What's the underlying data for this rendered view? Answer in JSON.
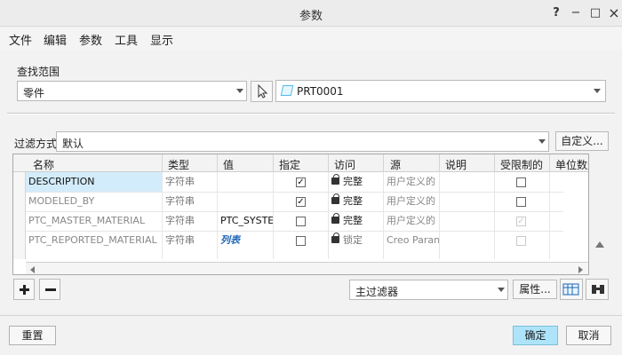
{
  "window": {
    "title": "参数",
    "help_label": "?",
    "minimize_label": "−",
    "maximize_label": "□",
    "close_label": "×"
  },
  "menu": [
    "文件",
    "编辑",
    "参数",
    "工具",
    "显示"
  ],
  "search_scope": {
    "label": "查找范围",
    "type_value": "零件",
    "object_value": "PRT0001"
  },
  "filter": {
    "label": "过滤方式",
    "value": "默认",
    "custom_button": "自定义..."
  },
  "table": {
    "columns": [
      "名称",
      "类型",
      "值",
      "指定",
      "访问",
      "源",
      "说明",
      "受限制的",
      "单位数量"
    ],
    "rows": [
      {
        "name": "DESCRIPTION",
        "type": "字符串",
        "value": "",
        "designated": true,
        "access": "完整",
        "source": "用户定义的",
        "description": "",
        "restricted": false,
        "units": ""
      },
      {
        "name": "MODELED_BY",
        "type": "字符串",
        "value": "",
        "designated": true,
        "access": "完整",
        "source": "用户定义的",
        "description": "",
        "restricted": false,
        "units": ""
      },
      {
        "name": "PTC_MASTER_MATERIAL",
        "type": "字符串",
        "value": "PTC_SYSTE",
        "designated": false,
        "access": "完整",
        "source": "用户定义的",
        "description": "",
        "restricted": true,
        "units": ""
      },
      {
        "name": "PTC_REPORTED_MATERIAL",
        "type": "字符串",
        "value": "列表",
        "designated": false,
        "access": "锁定",
        "source": "Creo Paran",
        "description": "",
        "restricted": false,
        "units": ""
      }
    ]
  },
  "toolbar": {
    "main_filter": "主过滤器",
    "properties_button": "属性..."
  },
  "footer": {
    "reset_button": "重置",
    "ok_button": "确定",
    "cancel_button": "取消"
  },
  "colors": {
    "selected_row": "#d3ecfb",
    "ok_button": "#aee4fa",
    "list_value": "#1d65b7"
  }
}
